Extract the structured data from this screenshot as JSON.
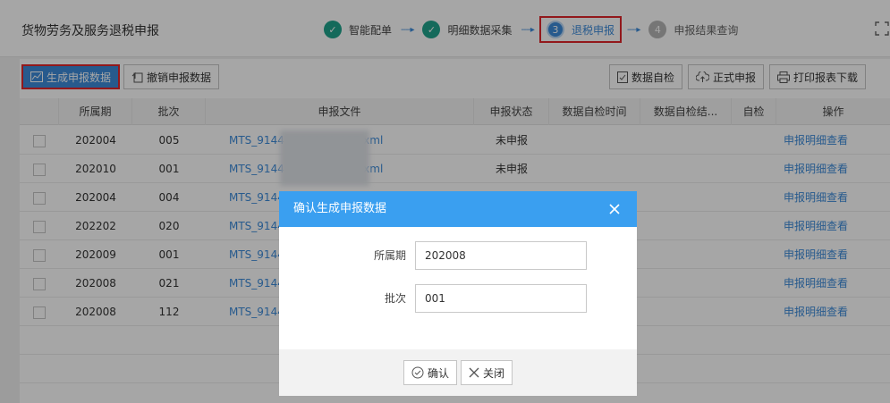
{
  "header": {
    "title": "货物劳务及服务退税申报",
    "steps": [
      {
        "number": "✓",
        "label": "智能配单",
        "state": "done"
      },
      {
        "number": "✓",
        "label": "明细数据采集",
        "state": "done"
      },
      {
        "number": "3",
        "label": "退税申报",
        "state": "active"
      },
      {
        "number": "4",
        "label": "申报结果查询",
        "state": "todo"
      }
    ],
    "arrow": "----▸"
  },
  "toolbar": {
    "generate_label": "生成申报数据",
    "revoke_label": "撤销申报数据",
    "self_check_label": "数据自检",
    "formal_declare_label": "正式申报",
    "print_download_label": "打印报表下载"
  },
  "table": {
    "headers": [
      "",
      "所属期",
      "批次",
      "申报文件",
      "申报状态",
      "数据自检时间",
      "数据自检结...",
      "自检",
      "操作"
    ],
    "rows": [
      {
        "period": "202004",
        "batch": "005",
        "file": "MTS_9144                    _202004_005.xml",
        "status": "未申报",
        "action": "申报明细查看"
      },
      {
        "period": "202010",
        "batch": "001",
        "file": "MTS_9144                    _202010_001.xml",
        "status": "未申报",
        "action": "申报明细查看"
      },
      {
        "period": "202004",
        "batch": "004",
        "file": "MTS_9144",
        "status": "",
        "action": "申报明细查看"
      },
      {
        "period": "202202",
        "batch": "020",
        "file": "MTS_9144",
        "status": "",
        "action": "申报明细查看"
      },
      {
        "period": "202009",
        "batch": "001",
        "file": "MTS_9144",
        "status": "",
        "action": "申报明细查看"
      },
      {
        "period": "202008",
        "batch": "021",
        "file": "MTS_9144",
        "status": "",
        "action": "申报明细查看"
      },
      {
        "period": "202008",
        "batch": "112",
        "file": "MTS_9144",
        "status": "",
        "action": "申报明细查看"
      }
    ]
  },
  "modal": {
    "title": "确认生成申报数据",
    "period_label": "所属期",
    "period_value": "202008",
    "batch_label": "批次",
    "batch_value": "001",
    "confirm_label": "确认",
    "close_label": "关闭"
  },
  "icons": {
    "check": "check-icon",
    "chart": "chart-icon",
    "undo": "undo-icon",
    "self_check": "document-check-icon",
    "upload": "cloud-upload-icon",
    "print": "printer-icon",
    "close": "close-icon",
    "expand": "expand-icon"
  },
  "colors": {
    "primary": "#3c8bd9",
    "modal_header": "#3a9ff0",
    "done": "#1fa38c",
    "highlight": "#e0262a"
  }
}
